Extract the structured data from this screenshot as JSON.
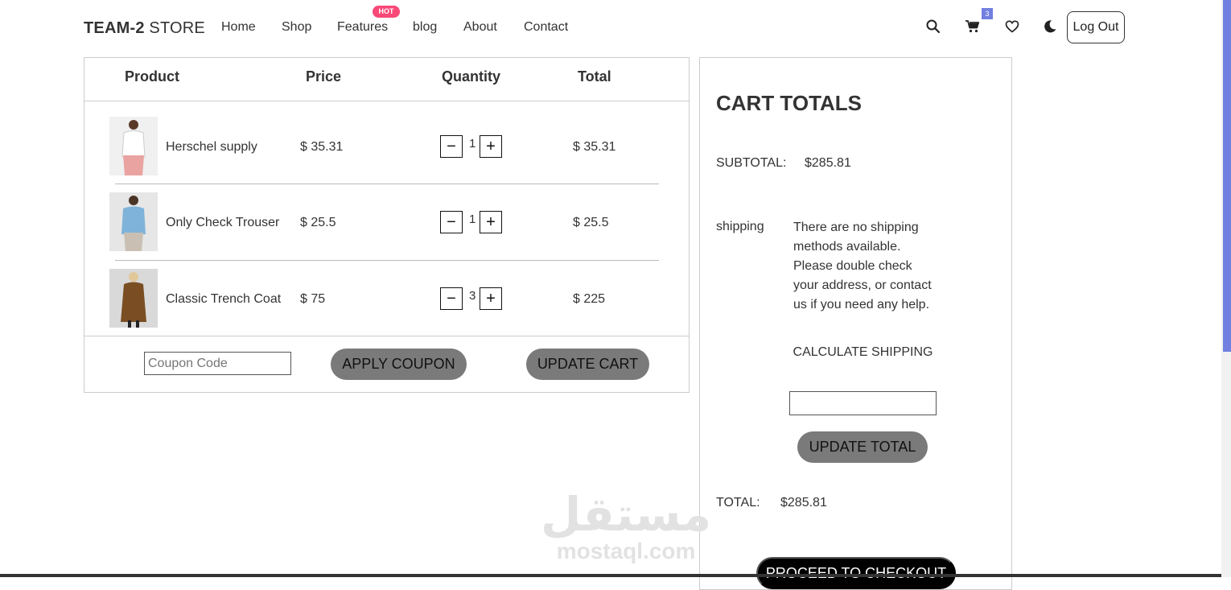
{
  "header": {
    "brand_bold": "TEAM-2",
    "brand_light": " STORE",
    "nav": [
      "Home",
      "Shop",
      "Features",
      "blog",
      "About",
      "Contact"
    ],
    "hot_badge": "HOT",
    "cart_count": "3",
    "logout_label": "Log Out",
    "icons": [
      "search-icon",
      "cart-icon",
      "heart-icon",
      "moon-icon"
    ]
  },
  "cart": {
    "headers": {
      "product": "Product",
      "price": "Price",
      "quantity": "Quantity",
      "total": "Total"
    },
    "items": [
      {
        "name": "Herschel supply",
        "price": "$ 35.31",
        "qty": "1",
        "total": "$ 35.31"
      },
      {
        "name": "Only Check Trouser",
        "price": "$ 25.5",
        "qty": "1",
        "total": "$ 25.5"
      },
      {
        "name": "Classic Trench Coat",
        "price": "$ 75",
        "qty": "3",
        "total": "$ 225"
      }
    ],
    "coupon_placeholder": "Coupon Code",
    "apply_label": "APPLY COUPON",
    "update_label": "UPDATE CART",
    "minus": "−",
    "plus": "+"
  },
  "totals": {
    "title": "CART TOTALS",
    "subtotal_label": "SUBTOTAL:",
    "subtotal_value": "$285.81",
    "shipping_label": "shipping",
    "shipping_note": "There are no shipping methods available. Please double check your address, or contact us if you need any help.",
    "calc_label": "CALCULATE SHIPPING",
    "update_total_label": "UPDATE TOTAL",
    "total_label": "TOTAL:",
    "total_value": "$285.81",
    "checkout_label": "PROCEED TO CHECKOUT"
  },
  "watermark": {
    "arabic": "مستقل",
    "latin": "mostaql.com"
  },
  "colors": {
    "accent": "#717fe0",
    "hot": "#f74877",
    "button_gray": "#7a7a7a"
  }
}
